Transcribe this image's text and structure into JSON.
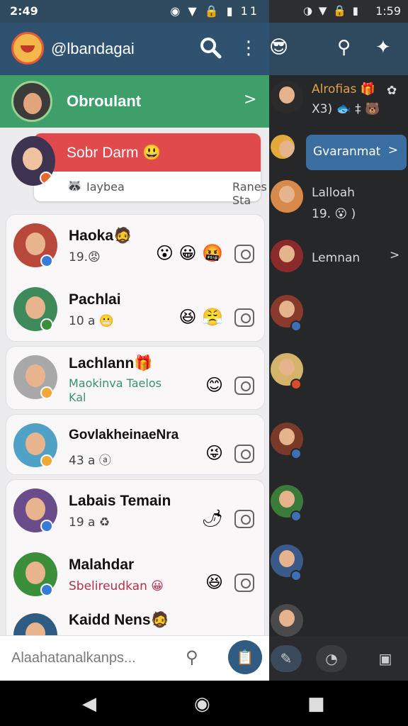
{
  "status": {
    "time": "2:49",
    "icons": "◉ ▼ 🔒 ▮ 11"
  },
  "right_status": {
    "icons": "◑ ▼ 🔒 ▮",
    "time": "1:59"
  },
  "appbar": {
    "handle": "@lbandagai"
  },
  "banner": {
    "title": "Obroulant",
    "chevron": ">"
  },
  "promo": {
    "title": "Sobr Darm 😃",
    "footer_left": "Iaybea",
    "footer_right": "Ranes Sta",
    "footer_icon": "🦝"
  },
  "chats": [
    {
      "name": "Haoka🧔",
      "sub": "19.😡",
      "reacts": "😮 😀 🤬",
      "avatar_color": "#b8493a",
      "badge_color": "#3a7bd5"
    },
    {
      "name": "Pachlai",
      "sub": "10 a 😬",
      "reacts": "😆 😤",
      "avatar_color": "#3e8a5a",
      "badge_color": "#3b8f3b"
    },
    {
      "name": "Lachlann🎁",
      "sub": "Maokinva Taelos\nKal",
      "reacts": "😊",
      "avatar_color": "#a8a8a8",
      "badge_color": "#f0a83a"
    },
    {
      "name": "GovlakheinaeNra",
      "sub": "43 a ⓐ",
      "reacts": "😜",
      "avatar_color": "#4fa1c6",
      "badge_color": "#f0a83a"
    },
    {
      "name": "Labais Temain",
      "sub": "19 a ♻",
      "reacts": "🌶",
      "avatar_color": "#6a4c8a",
      "badge_color": "#3a7bd5"
    },
    {
      "name": "Malahdar",
      "sub": "Sbelireudkan 😀",
      "reacts": "😆",
      "avatar_color": "#3b8f3b",
      "badge_color": "#3a7bd5"
    },
    {
      "name": "Kaidd Nens🧔",
      "sub": "",
      "reacts": "",
      "avatar_color": "#2f5c82",
      "badge_color": "#3a7bd5"
    }
  ],
  "compose": {
    "placeholder": "Alaahatanalkanps...",
    "fab_icon": "📋"
  },
  "right_header": {
    "avatar_icon": "😎",
    "search_icon": "⚲",
    "puzzle_icon": "✦"
  },
  "right_chats": {
    "first_name": "Alrofias 🎁",
    "first_sub": "X3) 🐟 ‡ 🐻",
    "active_label": "Gvaranmat",
    "active_chevron": ">",
    "second_name": "Lalloah",
    "second_sub": "19. 😮 )",
    "third_name": "Lemnan",
    "third_chevron": ">"
  },
  "nav": {
    "back": "◀",
    "home": "◉",
    "recent": "■"
  }
}
